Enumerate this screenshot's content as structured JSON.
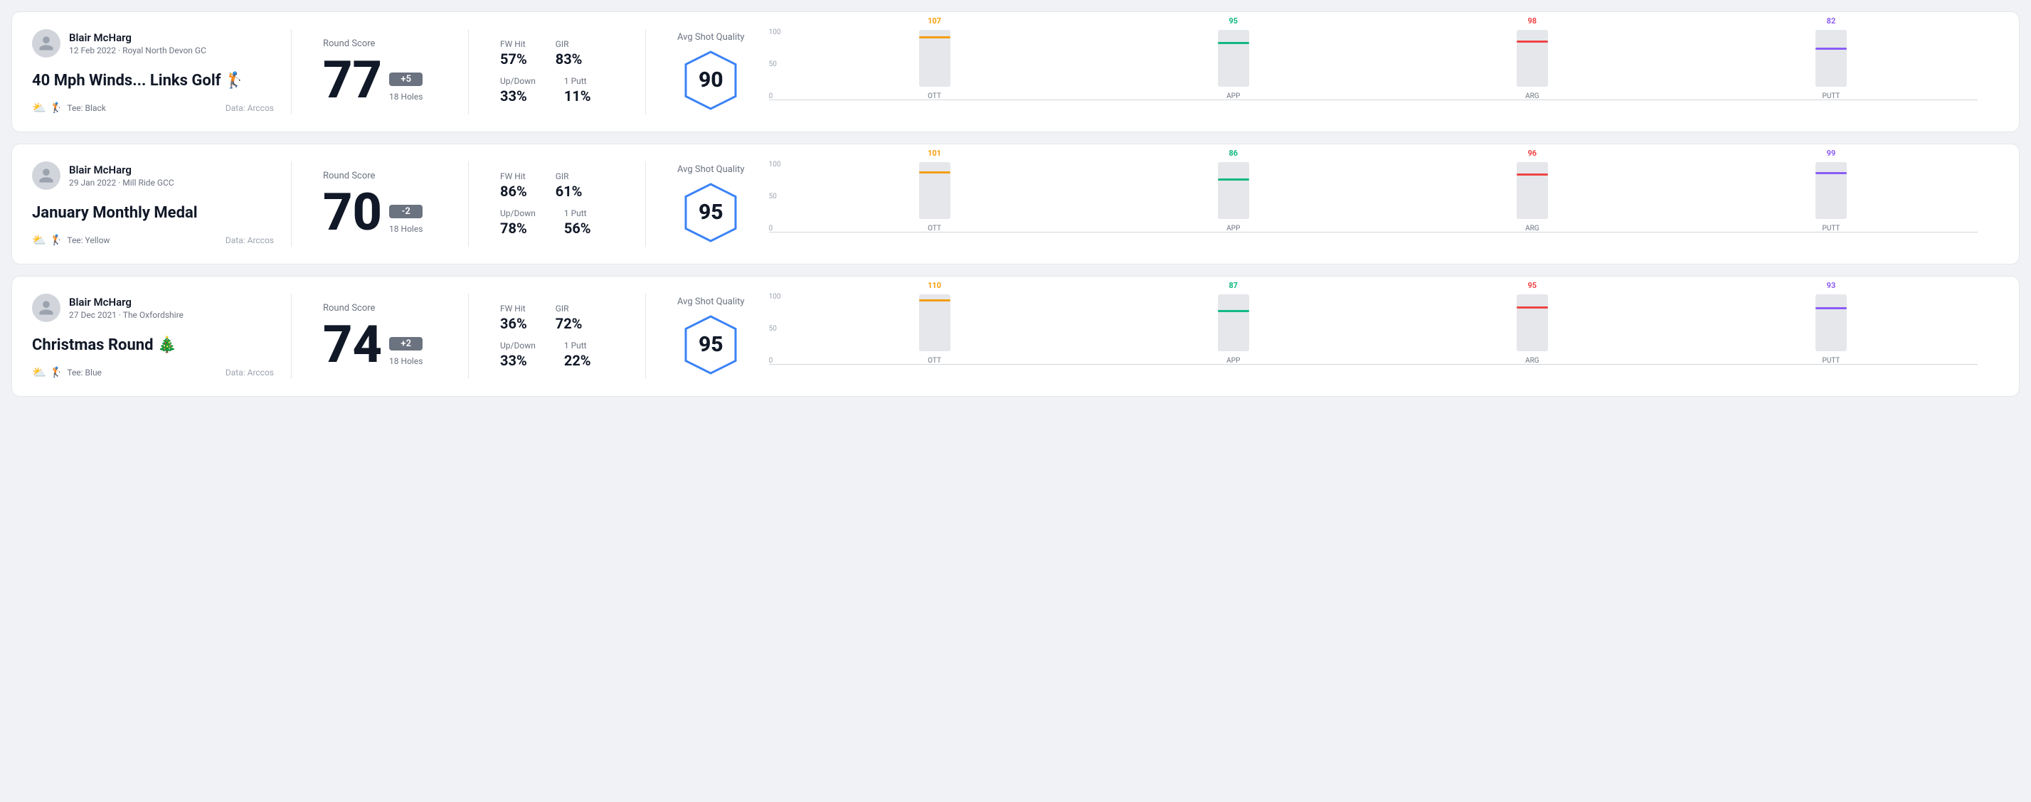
{
  "rounds": [
    {
      "id": "round1",
      "user": {
        "name": "Blair McHarg",
        "meta": "12 Feb 2022 · Royal North Devon GC"
      },
      "title": "40 Mph Winds... Links Golf 🏌️",
      "tee": "Black",
      "data_source": "Data: Arccos",
      "score": {
        "label": "Round Score",
        "number": "77",
        "badge": "+5",
        "badge_type": "over",
        "holes": "18 Holes"
      },
      "stats": {
        "fw_hit_label": "FW Hit",
        "fw_hit_value": "57%",
        "gir_label": "GIR",
        "gir_value": "83%",
        "updown_label": "Up/Down",
        "updown_value": "33%",
        "oneputt_label": "1 Putt",
        "oneputt_value": "11%"
      },
      "quality": {
        "label": "Avg Shot Quality",
        "score": "90"
      },
      "chart": {
        "bars": [
          {
            "label": "OTT",
            "value": 107,
            "color_class": "color-ott",
            "line_class": "line-ott"
          },
          {
            "label": "APP",
            "value": 95,
            "color_class": "color-app",
            "line_class": "line-app"
          },
          {
            "label": "ARG",
            "value": 98,
            "color_class": "color-arg",
            "line_class": "line-arg"
          },
          {
            "label": "PUTT",
            "value": 82,
            "color_class": "color-putt",
            "line_class": "line-putt"
          }
        ],
        "y_labels": [
          "100",
          "50",
          "0"
        ]
      }
    },
    {
      "id": "round2",
      "user": {
        "name": "Blair McHarg",
        "meta": "29 Jan 2022 · Mill Ride GCC"
      },
      "title": "January Monthly Medal",
      "tee": "Yellow",
      "data_source": "Data: Arccos",
      "score": {
        "label": "Round Score",
        "number": "70",
        "badge": "-2",
        "badge_type": "under",
        "holes": "18 Holes"
      },
      "stats": {
        "fw_hit_label": "FW Hit",
        "fw_hit_value": "86%",
        "gir_label": "GIR",
        "gir_value": "61%",
        "updown_label": "Up/Down",
        "updown_value": "78%",
        "oneputt_label": "1 Putt",
        "oneputt_value": "56%"
      },
      "quality": {
        "label": "Avg Shot Quality",
        "score": "95"
      },
      "chart": {
        "bars": [
          {
            "label": "OTT",
            "value": 101,
            "color_class": "color-ott",
            "line_class": "line-ott"
          },
          {
            "label": "APP",
            "value": 86,
            "color_class": "color-app",
            "line_class": "line-app"
          },
          {
            "label": "ARG",
            "value": 96,
            "color_class": "color-arg",
            "line_class": "line-arg"
          },
          {
            "label": "PUTT",
            "value": 99,
            "color_class": "color-putt",
            "line_class": "line-putt"
          }
        ],
        "y_labels": [
          "100",
          "50",
          "0"
        ]
      }
    },
    {
      "id": "round3",
      "user": {
        "name": "Blair McHarg",
        "meta": "27 Dec 2021 · The Oxfordshire"
      },
      "title": "Christmas Round 🎄",
      "tee": "Blue",
      "data_source": "Data: Arccos",
      "score": {
        "label": "Round Score",
        "number": "74",
        "badge": "+2",
        "badge_type": "over",
        "holes": "18 Holes"
      },
      "stats": {
        "fw_hit_label": "FW Hit",
        "fw_hit_value": "36%",
        "gir_label": "GIR",
        "gir_value": "72%",
        "updown_label": "Up/Down",
        "updown_value": "33%",
        "oneputt_label": "1 Putt",
        "oneputt_value": "22%"
      },
      "quality": {
        "label": "Avg Shot Quality",
        "score": "95"
      },
      "chart": {
        "bars": [
          {
            "label": "OTT",
            "value": 110,
            "color_class": "color-ott",
            "line_class": "line-ott"
          },
          {
            "label": "APP",
            "value": 87,
            "color_class": "color-app",
            "line_class": "line-app"
          },
          {
            "label": "ARG",
            "value": 95,
            "color_class": "color-arg",
            "line_class": "line-arg"
          },
          {
            "label": "PUTT",
            "value": 93,
            "color_class": "color-putt",
            "line_class": "line-putt"
          }
        ],
        "y_labels": [
          "100",
          "50",
          "0"
        ]
      }
    }
  ]
}
